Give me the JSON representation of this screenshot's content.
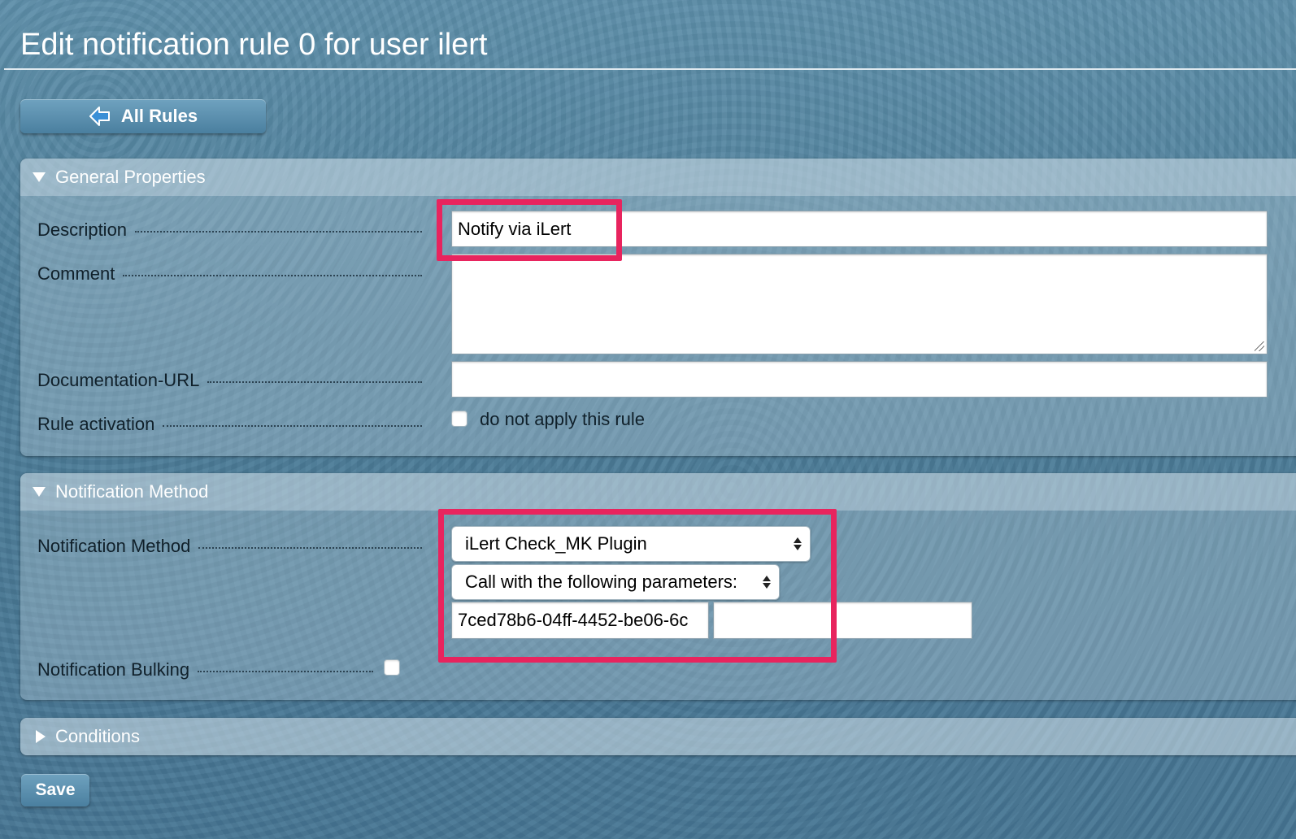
{
  "page": {
    "title": "Edit notification rule 0 for user ilert"
  },
  "toolbar": {
    "back_label": "All Rules",
    "back_icon": "arrow-left-icon"
  },
  "general": {
    "header": "General Properties",
    "description_label": "Description",
    "description_value": "Notify via iLert",
    "comment_label": "Comment",
    "comment_value": "",
    "docurl_label": "Documentation-URL",
    "docurl_value": "",
    "activation_label": "Rule activation",
    "activation_checkbox_label": "do not apply this rule",
    "activation_checked": false
  },
  "notification": {
    "header": "Notification Method",
    "method_label": "Notification Method",
    "method_selected": "iLert Check_MK Plugin",
    "params_selected": "Call with the following parameters:",
    "param1_value": "7ced78b6-04ff-4452-be06-6c",
    "param2_value": "",
    "bulking_label": "Notification Bulking",
    "bulking_checked": false
  },
  "conditions": {
    "header": "Conditions"
  },
  "footer": {
    "save_label": "Save"
  },
  "colors": {
    "highlight": "#e8245e",
    "background": "#4f7f9c",
    "button": "#5b8fad"
  }
}
